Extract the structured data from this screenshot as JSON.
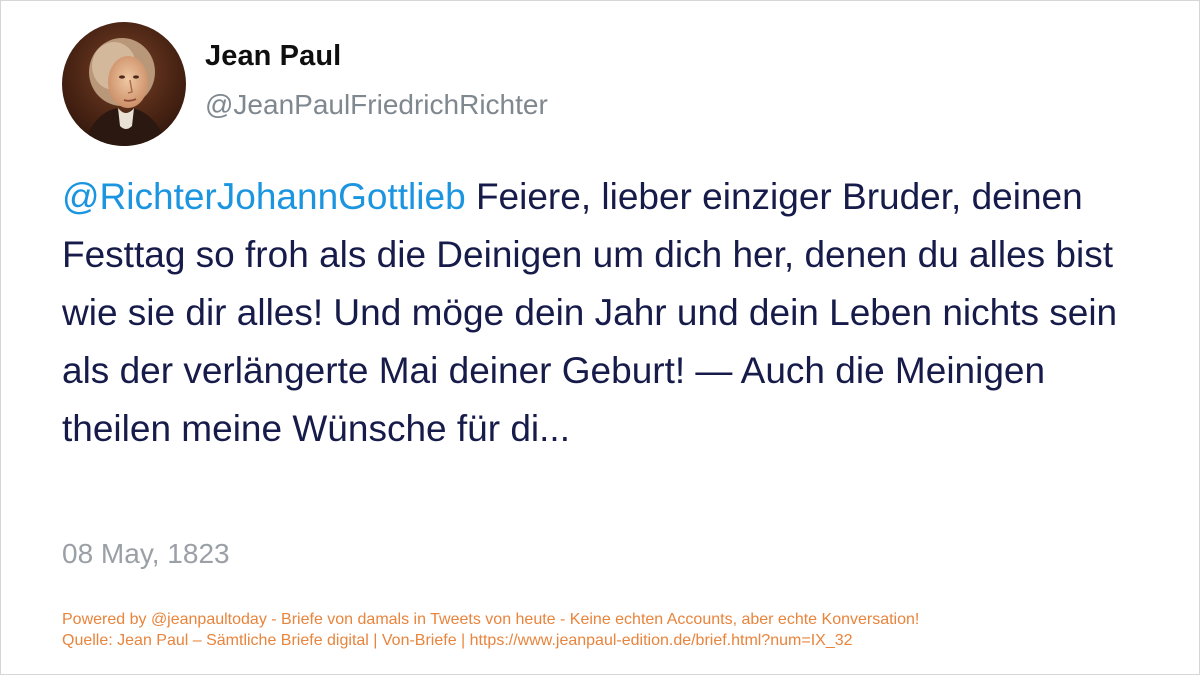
{
  "author": {
    "name": "Jean Paul",
    "handle": "@JeanPaulFriedrichRichter",
    "avatar_icon": "portrait-avatar"
  },
  "tweet": {
    "mention": "@RichterJohannGottlieb",
    "body": " Feiere, lieber einziger Bruder, deinen Festtag so froh als die Deinigen um dich her, denen du alles bist wie sie dir alles! Und möge dein Jahr und dein Leben nichts sein als der verlängerte Mai deiner Geburt! — Auch die Meinigen theilen meine Wünsche für di...",
    "date": "08 May, 1823"
  },
  "footer": {
    "line1": "Powered by @jeanpaultoday - Briefe von damals in Tweets von heute - Keine echten Accounts, aber echte Konversation!",
    "line2": "Quelle: Jean Paul – Sämtliche Briefe digital | Von-Briefe | https://www.jeanpaul-edition.de/brief.html?num=IX_32"
  },
  "colors": {
    "mention": "#1b95e0",
    "text": "#161b4a",
    "muted": "#9aa0a6",
    "footer": "#e8843c"
  }
}
